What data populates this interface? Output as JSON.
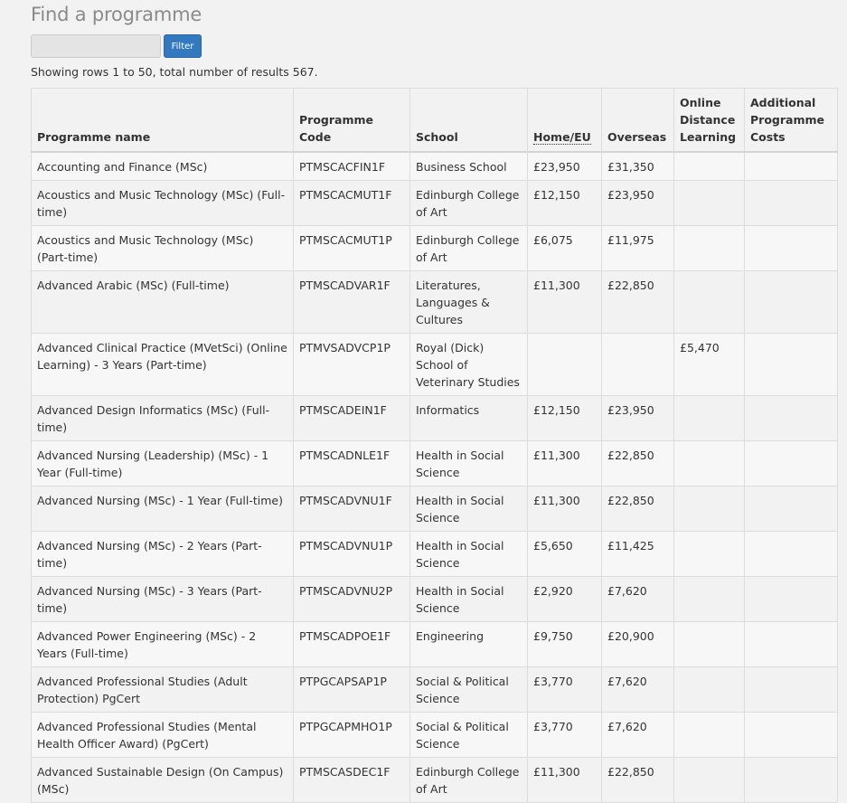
{
  "page": {
    "title": "Find a programme",
    "filter_button_label": "Filter",
    "filter_value": "",
    "result_summary": "Showing rows 1 to 50, total number of results 567."
  },
  "table": {
    "columns": [
      {
        "key": "name",
        "label": "Programme name"
      },
      {
        "key": "code",
        "label": "Programme Code"
      },
      {
        "key": "school",
        "label": "School"
      },
      {
        "key": "home",
        "label": "Home/EU"
      },
      {
        "key": "overseas",
        "label": "Overseas"
      },
      {
        "key": "online",
        "label": "Online Distance Learning"
      },
      {
        "key": "costs",
        "label": "Additional Programme Costs"
      }
    ],
    "rows": [
      {
        "name": "Accounting and Finance (MSc)",
        "code": "PTMSCACFIN1F",
        "school": "Business School",
        "home": "£23,950",
        "overseas": "£31,350",
        "online": "",
        "costs": ""
      },
      {
        "name": "Acoustics and Music Technology (MSc) (Full-time)",
        "code": "PTMSCACMUT1F",
        "school": "Edinburgh College of Art",
        "home": "£12,150",
        "overseas": "£23,950",
        "online": "",
        "costs": ""
      },
      {
        "name": "Acoustics and Music Technology (MSc) (Part-time)",
        "code": "PTMSCACMUT1P",
        "school": "Edinburgh College of Art",
        "home": "£6,075",
        "overseas": "£11,975",
        "online": "",
        "costs": ""
      },
      {
        "name": "Advanced Arabic (MSc) (Full-time)",
        "code": "PTMSCADVAR1F",
        "school": "Literatures, Languages & Cultures",
        "home": "£11,300",
        "overseas": "£22,850",
        "online": "",
        "costs": ""
      },
      {
        "name": "Advanced Clinical Practice (MVetSci) (Online Learning) - 3 Years (Part-time)",
        "code": "PTMVSADVCP1P",
        "school": "Royal (Dick) School of Veterinary Studies",
        "home": "",
        "overseas": "",
        "online": "£5,470",
        "costs": ""
      },
      {
        "name": "Advanced Design Informatics (MSc) (Full-time)",
        "code": "PTMSCADEIN1F",
        "school": "Informatics",
        "home": "£12,150",
        "overseas": "£23,950",
        "online": "",
        "costs": ""
      },
      {
        "name": "Advanced Nursing (Leadership) (MSc) - 1 Year (Full-time)",
        "code": "PTMSCADNLE1F",
        "school": "Health in Social Science",
        "home": "£11,300",
        "overseas": "£22,850",
        "online": "",
        "costs": ""
      },
      {
        "name": "Advanced Nursing (MSc) - 1 Year (Full-time)",
        "code": "PTMSCADVNU1F",
        "school": "Health in Social Science",
        "home": "£11,300",
        "overseas": "£22,850",
        "online": "",
        "costs": ""
      },
      {
        "name": "Advanced Nursing (MSc) - 2 Years (Part-time)",
        "code": "PTMSCADVNU1P",
        "school": "Health in Social Science",
        "home": "£5,650",
        "overseas": "£11,425",
        "online": "",
        "costs": ""
      },
      {
        "name": "Advanced Nursing (MSc) - 3 Years (Part-time)",
        "code": "PTMSCADVNU2P",
        "school": "Health in Social Science",
        "home": "£2,920",
        "overseas": "£7,620",
        "online": "",
        "costs": ""
      },
      {
        "name": "Advanced Power Engineering (MSc) - 2 Years (Full-time)",
        "code": "PTMSCADPOE1F",
        "school": "Engineering",
        "home": "£9,750",
        "overseas": "£20,900",
        "online": "",
        "costs": ""
      },
      {
        "name": "Advanced Professional Studies (Adult Protection) PgCert",
        "code": "PTPGCAPSAP1P",
        "school": "Social & Political Science",
        "home": "£3,770",
        "overseas": "£7,620",
        "online": "",
        "costs": ""
      },
      {
        "name": "Advanced Professional Studies (Mental Health Officer Award) (PgCert)",
        "code": "PTPGCAPMHO1P",
        "school": "Social & Political Science",
        "home": "£3,770",
        "overseas": "£7,620",
        "online": "",
        "costs": ""
      },
      {
        "name": "Advanced Sustainable Design (On Campus) (MSc)",
        "code": "PTMSCASDEC1F",
        "school": "Edinburgh College of Art",
        "home": "£11,300",
        "overseas": "£22,850",
        "online": "",
        "costs": ""
      }
    ]
  }
}
